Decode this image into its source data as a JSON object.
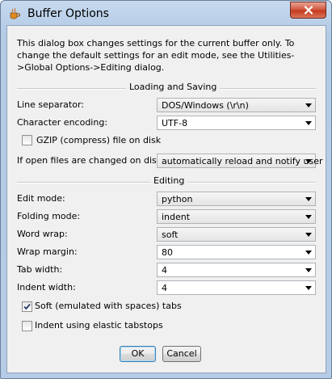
{
  "window": {
    "title": "Buffer Options",
    "app_icon": "coffee-cup-icon"
  },
  "intro_text": "This dialog box changes settings for the current buffer only. To change the default settings for an edit mode, see the Utilities->Global Options->Editing dialog.",
  "loading": {
    "title": "Loading and Saving",
    "line_separator_label": "Line separator:",
    "line_separator_value": "DOS/Windows (\\r\\n)",
    "encoding_label": "Character encoding:",
    "encoding_value": "UTF-8",
    "gzip_label": "GZIP (compress) file on disk",
    "gzip_checked": false,
    "changed_label": "If open files are changed on disk:",
    "changed_value": "automatically reload and notify user"
  },
  "editing": {
    "title": "Editing",
    "edit_mode_label": "Edit mode:",
    "edit_mode_value": "python",
    "folding_label": "Folding mode:",
    "folding_value": "indent",
    "word_wrap_label": "Word wrap:",
    "word_wrap_value": "soft",
    "wrap_margin_label": "Wrap margin:",
    "wrap_margin_value": "80",
    "tab_width_label": "Tab width:",
    "tab_width_value": "4",
    "indent_width_label": "Indent width:",
    "indent_width_value": "4",
    "soft_tabs_label": "Soft (emulated with spaces) tabs",
    "soft_tabs_checked": true,
    "elastic_label": "Indent using elastic tabstops",
    "elastic_checked": false
  },
  "buttons": {
    "ok": "OK",
    "cancel": "Cancel"
  }
}
